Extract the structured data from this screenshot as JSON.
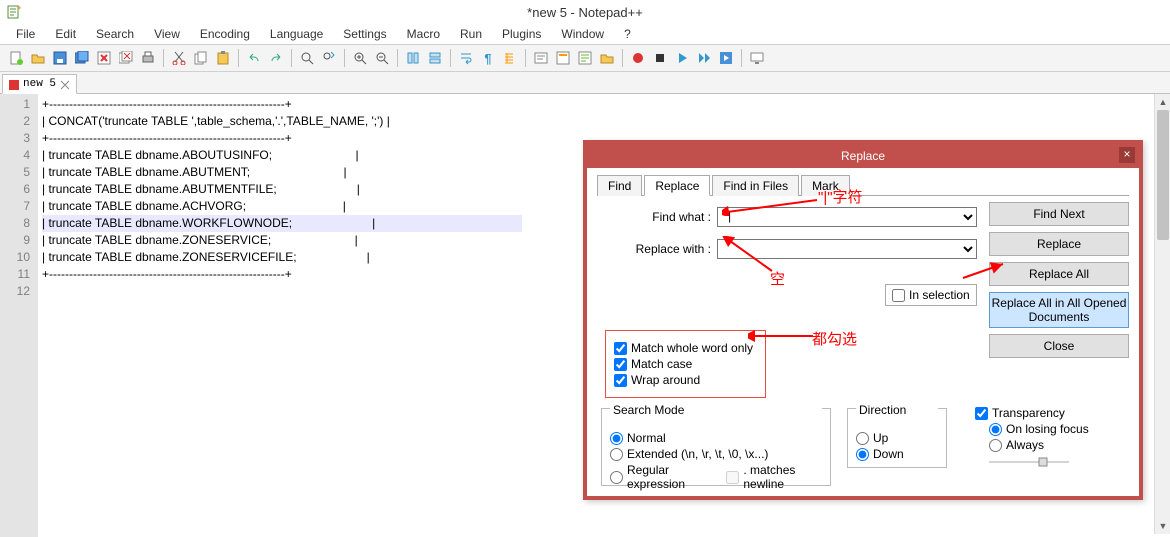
{
  "window": {
    "title": "*new  5 - Notepad++"
  },
  "menu": [
    "File",
    "Edit",
    "Search",
    "View",
    "Encoding",
    "Language",
    "Settings",
    "Macro",
    "Run",
    "Plugins",
    "Window",
    "?"
  ],
  "tab": {
    "label": "new  5"
  },
  "lines": [
    "+-----------------------------------------------------------+",
    "| CONCAT('truncate TABLE ',table_schema,'.',TABLE_NAME, ';') |",
    "+-----------------------------------------------------------+",
    "| truncate TABLE dbname.ABOUTUSINFO;                         |",
    "| truncate TABLE dbname.ABUTMENT;                            |",
    "| truncate TABLE dbname.ABUTMENTFILE;                        |",
    "| truncate TABLE dbname.ACHVORG;                             |",
    "| truncate TABLE dbname.WORKFLOWNODE;                        |",
    "| truncate TABLE dbname.ZONESERVICE;                         |",
    "| truncate TABLE dbname.ZONESERVICEFILE;                     |",
    "+-----------------------------------------------------------+",
    ""
  ],
  "highlighted_line_index": 7,
  "dialog": {
    "title": "Replace",
    "tabs": [
      "Find",
      "Replace",
      "Find in Files",
      "Mark"
    ],
    "active_tab": 1,
    "labels": {
      "find_what": "Find what :",
      "replace_with": "Replace with :",
      "in_selection": "In selection"
    },
    "values": {
      "find_what": "|",
      "replace_with": ""
    },
    "buttons": {
      "find_next": "Find Next",
      "replace": "Replace",
      "replace_all": "Replace All",
      "replace_all_opened": "Replace All in All Opened Documents",
      "close": "Close"
    },
    "checks": {
      "match_whole_word": "Match whole word only",
      "match_case": "Match case",
      "wrap_around": "Wrap around"
    },
    "search_mode": {
      "legend": "Search Mode",
      "normal": "Normal",
      "extended": "Extended (\\n, \\r, \\t, \\0, \\x...)",
      "regex": "Regular expression",
      "matches_newline": ". matches newline"
    },
    "direction": {
      "legend": "Direction",
      "up": "Up",
      "down": "Down"
    },
    "transparency": {
      "label": "Transparency",
      "on_losing_focus": "On losing focus",
      "always": "Always"
    }
  },
  "annotations": {
    "pipe_char": "\"|\"字符",
    "empty": "空",
    "check_all": "都勾选"
  }
}
